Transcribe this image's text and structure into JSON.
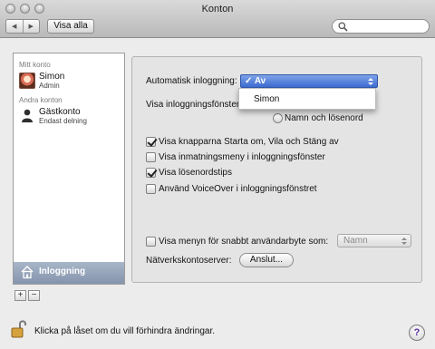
{
  "window": {
    "title": "Konton"
  },
  "toolbar": {
    "back_icon": "back-arrow-icon",
    "forward_icon": "forward-arrow-icon",
    "show_all_label": "Visa alla",
    "search_placeholder": "",
    "search_icon": "magnifier-icon"
  },
  "sidebar": {
    "my_account_header": "Mitt konto",
    "my_account": {
      "name": "Simon",
      "role": "Admin"
    },
    "other_accounts_header": "Andra konton",
    "other_accounts": [
      {
        "name": "Gästkonto",
        "role": "Endast delning"
      }
    ],
    "login_options_label": "Inloggning",
    "add_label": "+",
    "remove_label": "−"
  },
  "panel": {
    "auto_login_label": "Automatisk inloggning:",
    "auto_login_value": "Av",
    "auto_login_check": "✓",
    "auto_login_options": [
      "Av",
      "Simon"
    ],
    "show_login_window_label": "Visa inloggningsfönster",
    "radio_name_password_label": "Namn och lösenord",
    "checkboxes": [
      {
        "label": "Visa knapparna Starta om, Vila och Stäng av",
        "checked": true
      },
      {
        "label": "Visa inmatningsmeny i inloggningsfönster",
        "checked": false
      },
      {
        "label": "Visa lösenordstips",
        "checked": true
      },
      {
        "label": "Använd VoiceOver i inloggningsfönstret",
        "checked": false
      }
    ],
    "fast_user_switch_label": "Visa menyn för snabbt användarbyte som:",
    "fast_user_switch_checked": false,
    "fast_user_switch_value": "Namn",
    "network_server_label": "Nätverkskontoserver:",
    "join_button_label": "Anslut..."
  },
  "footer": {
    "lock_text": "Klicka på låset om du vill förhindra ändringar.",
    "help_label": "?"
  },
  "colors": {
    "selection": "#3d6bd1",
    "sidebar_selected": "#8494ad"
  }
}
